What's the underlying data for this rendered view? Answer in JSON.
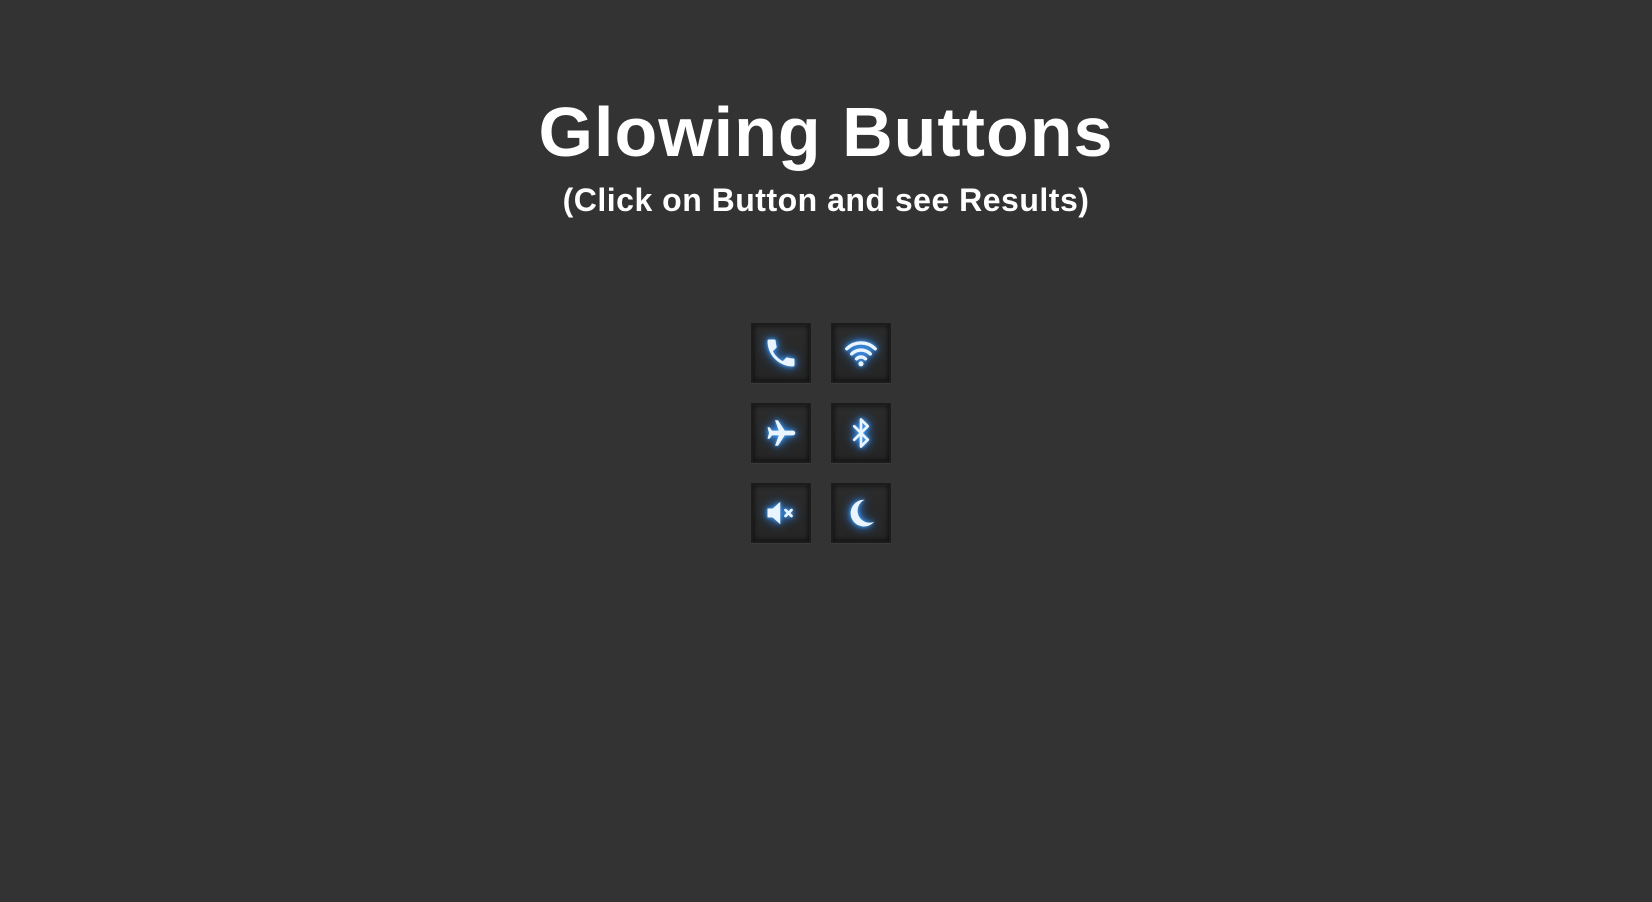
{
  "page": {
    "title": "Glowing Buttons",
    "subtitle": "(Click on Button and see Results)"
  },
  "colors": {
    "background": "#333333",
    "text": "#ffffff",
    "button_face": "#2a2a2a",
    "glow": "#2a8cff",
    "icon": "#eaf4ff"
  },
  "buttons": [
    {
      "icon": "phone-icon"
    },
    {
      "icon": "wifi-icon"
    },
    {
      "icon": "airplane-icon"
    },
    {
      "icon": "bluetooth-icon"
    },
    {
      "icon": "mute-icon"
    },
    {
      "icon": "moon-icon"
    }
  ]
}
